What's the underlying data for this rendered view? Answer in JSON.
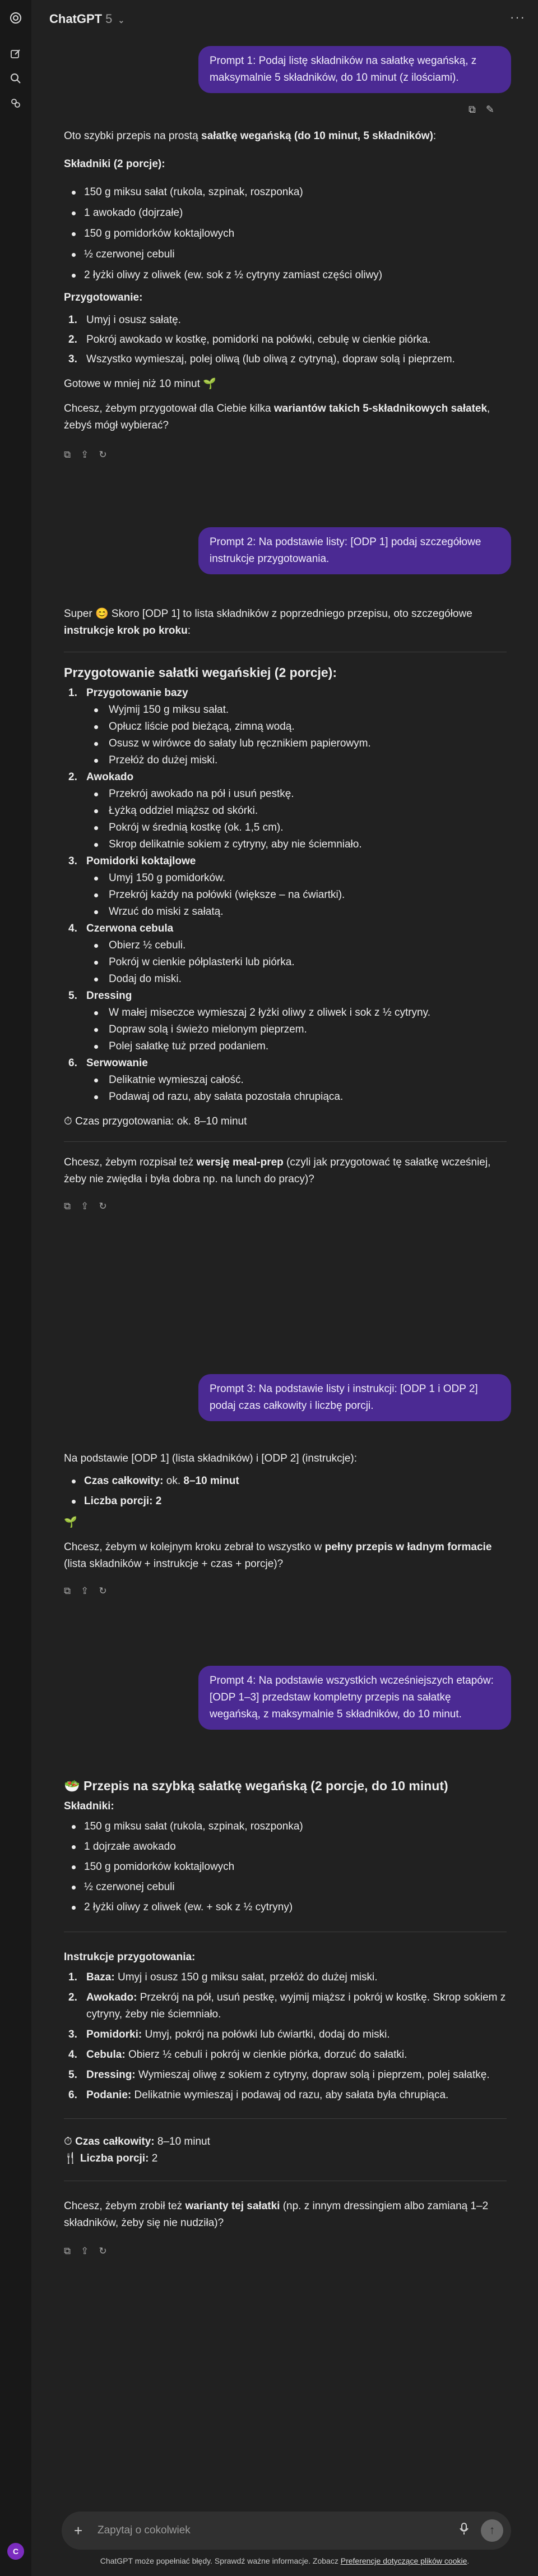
{
  "app": {
    "model_name": "ChatGPT",
    "model_version": "5",
    "avatar_letter": "C"
  },
  "messages": {
    "u1": "Prompt 1: Podaj listę składników na sałatkę wegańską, z maksymalnie 5 składników, do 10 minut (z ilościami).",
    "a1": {
      "intro_pre": "Oto szybki przepis na prostą ",
      "intro_bold": "sałatkę wegańską (do 10 minut, 5 składników)",
      "intro_post": ":",
      "ing_heading": "Składniki (2 porcje):",
      "ingredients": [
        "150 g miksu sałat (rukola, szpinak, roszponka)",
        "1 awokado (dojrzałe)",
        "150 g pomidorków koktajlowych",
        "½ czerwonej cebuli",
        "2 łyżki oliwy z oliwek (ew. sok z ½ cytryny zamiast części oliwy)"
      ],
      "prep_heading": "Przygotowanie:",
      "steps": [
        "Umyj i osusz sałatę.",
        "Pokrój awokado w kostkę, pomidorki na połówki, cebulę w cienkie piórka.",
        "Wszystko wymieszaj, polej oliwą (lub oliwą z cytryną), dopraw solą i pieprzem."
      ],
      "ready": "Gotowe w mniej niż 10 minut 🌱",
      "q_pre": "Chcesz, żebym przygotował dla Ciebie kilka ",
      "q_bold": "wariantów takich 5-składnikowych sałatek",
      "q_post": ", żebyś mógł wybierać?"
    },
    "u2": "Prompt 2: Na podstawie listy: [ODP 1] podaj szczegółowe instrukcje przygotowania.",
    "a2": {
      "intro_pre": "Super 😊 Skoro [ODP 1] to lista składników z poprzedniego przepisu, oto szczegółowe ",
      "intro_bold": "instrukcje krok po kroku",
      "intro_post": ":",
      "title": "Przygotowanie sałatki wegańskiej (2 porcje):",
      "sections": [
        {
          "title": "Przygotowanie bazy",
          "items": [
            "Wyjmij 150 g miksu sałat.",
            "Opłucz liście pod bieżącą, zimną wodą.",
            "Osusz w wirówce do sałaty lub ręcznikiem papierowym.",
            "Przełóż do dużej miski."
          ]
        },
        {
          "title": "Awokado",
          "items": [
            "Przekrój awokado na pół i usuń pestkę.",
            "Łyżką oddziel miąższ od skórki.",
            "Pokrój w średnią kostkę (ok. 1,5 cm).",
            "Skrop delikatnie sokiem z cytryny, aby nie ściemniało."
          ]
        },
        {
          "title": "Pomidorki koktajlowe",
          "items": [
            "Umyj 150 g pomidorków.",
            "Przekrój każdy na połówki (większe – na ćwiartki).",
            "Wrzuć do miski z sałatą."
          ]
        },
        {
          "title": "Czerwona cebula",
          "items": [
            "Obierz ½ cebuli.",
            "Pokrój w cienkie półplasterki lub piórka.",
            "Dodaj do miski."
          ]
        },
        {
          "title": "Dressing",
          "items": [
            "W małej miseczce wymieszaj 2 łyżki oliwy z oliwek i sok z ½ cytryny.",
            "Dopraw solą i świeżo mielonym pieprzem.",
            "Polej sałatkę tuż przed podaniem."
          ]
        },
        {
          "title": "Serwowanie",
          "items": [
            "Delikatnie wymieszaj całość.",
            "Podawaj od razu, aby sałata pozostała chrupiąca."
          ]
        }
      ],
      "time": "⏱ Czas przygotowania: ok. 8–10 minut",
      "q_pre": "Chcesz, żebym rozpisał też ",
      "q_bold": "wersję meal-prep",
      "q_post": " (czyli jak przygotować tę sałatkę wcześniej, żeby nie zwiędła i była dobra np. na lunch do pracy)?"
    },
    "u3": "Prompt 3: Na podstawie listy i instrukcji: [ODP 1 i ODP 2] podaj czas całkowity i liczbę porcji.",
    "a3": {
      "intro": "Na podstawie [ODP 1] (lista składników) i [ODP 2] (instrukcje):",
      "total_label": "Czas całkowity:",
      "total_pre": " ok. ",
      "total_val": "8–10 minut",
      "portions_label": "Liczba porcji:",
      "portions_val": " 2",
      "emoji": "🌱",
      "q_pre": "Chcesz, żebym w kolejnym kroku zebrał to wszystko w ",
      "q_bold": "pełny przepis w ładnym formacie",
      "q_post": " (lista składników + instrukcje + czas + porcje)?"
    },
    "u4": "Prompt 4: Na podstawie wszystkich wcześniejszych etapów: [ODP 1–3] przedstaw kompletny przepis na sałatkę wegańską, z maksymalnie 5 składników, do 10 minut.",
    "a4": {
      "title": "🥗 Przepis na szybką sałatkę wegańską (2 porcje, do 10 minut)",
      "ing_heading": "Składniki:",
      "ingredients": [
        "150 g miksu sałat (rukola, szpinak, roszponka)",
        "1 dojrzałe awokado",
        "150 g pomidorków koktajlowych",
        "½ czerwonej cebuli",
        "2 łyżki oliwy z oliwek (ew. + sok z ½ cytryny)"
      ],
      "prep_heading": "Instrukcje przygotowania:",
      "steps": [
        {
          "label": "Baza:",
          "text": " Umyj i osusz 150 g miksu sałat, przełóż do dużej miski."
        },
        {
          "label": "Awokado:",
          "text": " Przekrój na pół, usuń pestkę, wyjmij miąższ i pokrój w kostkę. Skrop sokiem z cytryny, żeby nie ściemniało."
        },
        {
          "label": "Pomidorki:",
          "text": " Umyj, pokrój na połówki lub ćwiartki, dodaj do miski."
        },
        {
          "label": "Cebula:",
          "text": " Obierz ½ cebuli i pokrój w cienkie piórka, dorzuć do sałatki."
        },
        {
          "label": "Dressing:",
          "text": " Wymieszaj oliwę z sokiem z cytryny, dopraw solą i pieprzem, polej sałatkę."
        },
        {
          "label": "Podanie:",
          "text": " Delikatnie wymieszaj i podawaj od razu, aby sałata była chrupiąca."
        }
      ],
      "total_icon": "⏱",
      "total_label": "Czas całkowity:",
      "total_val": " 8–10 minut",
      "portions_icon": "🍴",
      "portions_label": "Liczba porcji:",
      "portions_val": " 2",
      "q_pre": "Chcesz, żebym zrobił też ",
      "q_bold": "warianty tej sałatki",
      "q_post": " (np. z innym dressingiem albo zamianą 1–2 składników, żeby się nie nudziła)?"
    }
  },
  "input": {
    "placeholder": "Zapytaj o cokolwiek"
  },
  "footer": {
    "text": "ChatGPT może popełniać błędy. Sprawdź ważne informacje. Zobacz ",
    "link": "Preferencje dotyczące plików cookie",
    "end": "."
  },
  "icons": {
    "logo": "openai-logo-icon",
    "new_chat": "new-chat-icon",
    "search": "search-icon",
    "library": "library-icon",
    "menu": "more-options-icon",
    "copy": "copy-icon",
    "edit": "edit-icon",
    "share": "share-icon",
    "regenerate": "regenerate-icon",
    "plus": "plus-icon",
    "mic": "microphone-icon",
    "send": "send-icon"
  }
}
